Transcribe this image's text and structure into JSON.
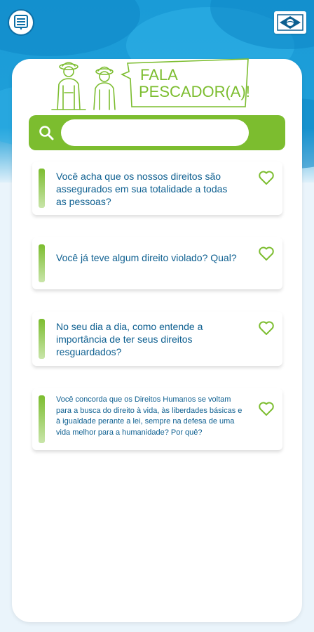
{
  "logo": {
    "title_line1": "FALA",
    "title_line2": "PESCADOR(A)!"
  },
  "search": {
    "placeholder": "",
    "value": ""
  },
  "questions": [
    {
      "text": "Você acha que os nossos direitos são assegurados em sua totalidade a todas as pessoas?"
    },
    {
      "text": "Você já teve algum direito violado? Qual?"
    },
    {
      "text": "No seu dia a dia, como entende a importância de ter seus direitos resguardados?"
    },
    {
      "text": "Você concorda que os Direitos Humanos se voltam para a busca do direito à vida, às liberdades básicas e à igualdade perante a lei, sempre na defesa de uma vida melhor para a humanidade? Por quê?"
    }
  ],
  "colors": {
    "accent_green": "#7cbd2f",
    "text_blue": "#0d5f90",
    "header_blue": "#1a9bd7"
  },
  "icons": {
    "menu": "list-icon",
    "flag": "brazil-seal-icon",
    "search": "search-icon",
    "favorite": "heart-outline-icon"
  }
}
